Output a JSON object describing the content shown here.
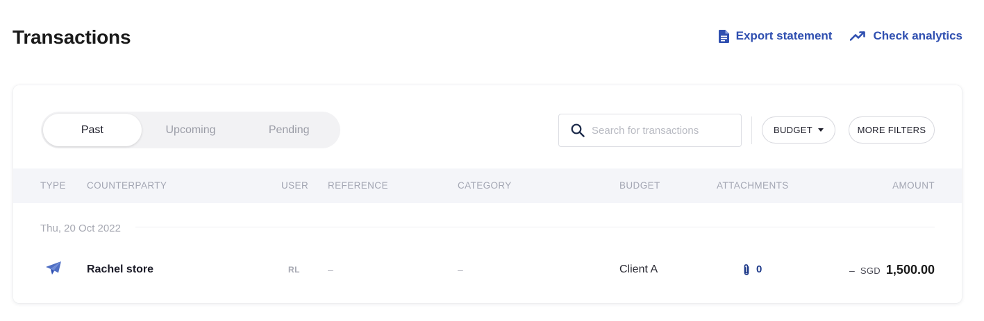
{
  "header": {
    "title": "Transactions",
    "export_label": "Export statement",
    "analytics_label": "Check analytics"
  },
  "tabs": [
    {
      "label": "Past",
      "active": true
    },
    {
      "label": "Upcoming",
      "active": false
    },
    {
      "label": "Pending",
      "active": false
    }
  ],
  "search": {
    "placeholder": "Search for transactions",
    "value": ""
  },
  "filters": {
    "budget_label": "BUDGET",
    "more_label": "MORE FILTERS"
  },
  "table": {
    "columns": [
      "TYPE",
      "COUNTERPARTY",
      "USER",
      "REFERENCE",
      "CATEGORY",
      "BUDGET",
      "ATTACHMENTS",
      "AMOUNT"
    ],
    "groups": [
      {
        "date": "Thu, 20 Oct 2022",
        "rows": [
          {
            "type_icon": "paper-plane-icon",
            "counterparty": "Rachel store",
            "user": "RL",
            "reference": "–",
            "category": "–",
            "budget": "Client A",
            "attachments": "0",
            "amount_sign": "–",
            "currency": "SGD",
            "amount": "1,500.00"
          }
        ]
      }
    ]
  },
  "colors": {
    "accent": "#2f4fb0",
    "header_bg": "#f4f5f9",
    "muted": "#a3a6b3"
  }
}
